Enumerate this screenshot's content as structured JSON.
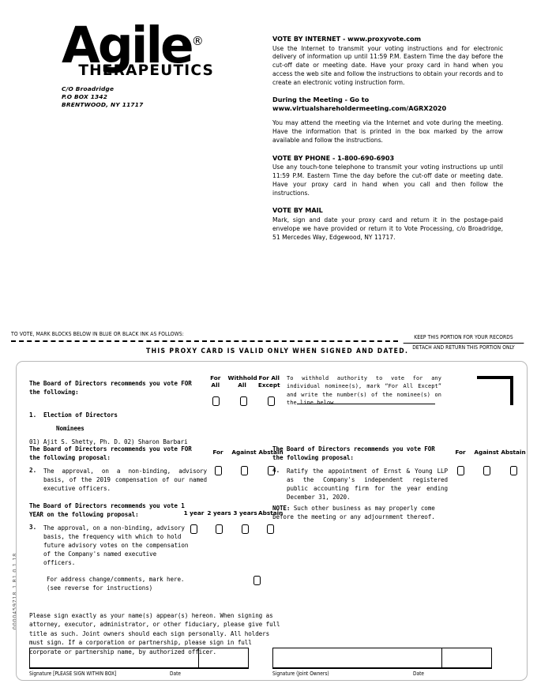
{
  "company": {
    "logo_text": "Agile",
    "logo_registered": "®",
    "logo_subtitle": "THERAPEUTICS",
    "address_line1": "C/O Broadridge",
    "address_line2": "P.O BOX 1342",
    "address_line3": "BRENTWOOD, NY 11717"
  },
  "instructions": {
    "internet_heading": "VOTE BY INTERNET - www.proxyvote.com",
    "internet_body": "Use the Internet to transmit your voting instructions and for electronic delivery of information up until 11:59 P.M. Eastern Time the day before the cut-off date or meeting date. Have your proxy card in hand when you access the web site and follow the instructions to obtain your records and to create an electronic voting instruction form.",
    "meeting_heading": "During the Meeting - Go to www.virtualshareholdermeeting.com/AGRX2020",
    "meeting_body": "You may attend the meeting via the Internet and vote during the meeting. Have the information that is printed in the box marked by the arrow available and follow the instructions.",
    "phone_heading": "VOTE BY PHONE - 1-800-690-6903",
    "phone_body": "Use any touch-tone telephone to transmit your voting instructions up until 11:59 P.M. Eastern Time the day before the cut-off date or meeting date. Have your proxy card in hand when you call and then follow the instructions.",
    "mail_heading": "VOTE BY MAIL",
    "mail_body": "Mark, sign and date your proxy card and return it in the postage-paid envelope we have provided or return it to Vote Processing, c/o Broadridge, 51 Mercedes Way, Edgewood, NY 11717."
  },
  "detach": {
    "mark_blocks": "TO VOTE, MARK BLOCKS BELOW IN BLUE OR BLACK INK AS FOLLOWS:",
    "valid_notice": "THIS  PROXY  CARD  IS  VALID  ONLY  WHEN  SIGNED  AND  DATED.",
    "keep_portion": "KEEP THIS PORTION FOR YOUR RECORDS",
    "detach_portion": "DETACH AND RETURN THIS PORTION ONLY"
  },
  "card": {
    "rec_for_following": "The Board of Directors recommends you vote FOR the following:",
    "rec_for_proposal": "The Board of Directors recommends you vote FOR the following proposal:",
    "rec_one_year": "The Board of Directors recommends you vote 1 YEAR on the following proposal:",
    "item1_num": "1.",
    "item1_title": "Election of Directors",
    "nominees_label": "Nominees",
    "nominee_1": "01) Ajit S. Shetty, Ph. D.",
    "nominee_2": "02) Sharon Barbari",
    "col_for_all": "For\nAll",
    "col_withhold_all": "Withhold\nAll",
    "col_for_all_except": "For All\nExcept",
    "withhold_note": "To withhold authority to vote for any individual nominee(s), mark “For All Except” and write the number(s) of the nominee(s) on the line below.",
    "item2_num": "2.",
    "item2_text": "The approval, on a non-binding, advisory basis, of the 2019 compensation of our named executive officers.",
    "item4_num": "4.",
    "item4_text": "Ratify the appointment of Ernst & Young LLP as the Company's independent registered public accounting firm for the year ending December 31, 2020.",
    "item3_num": "3.",
    "item3_text": "The approval, on a non-binding, advisory basis, the frequency with which to hold future advisory votes on the compensation of the Company's named executive officers.",
    "col_for": "For",
    "col_against": "Against",
    "col_abstain": "Abstain",
    "col_1_year": "1 year",
    "col_2_years": "2 years",
    "col_3_years": "3 years",
    "col_abstain_freq": "Abstain",
    "note_label": "NOTE:",
    "note_text": " Such other business as may properly come before the meeting or any adjournment thereof.",
    "address_change_line1": "For address change/comments, mark here.",
    "address_change_line2": "(see reverse for instructions)",
    "signature_instructions": "Please sign exactly as your name(s) appear(s) hereon. When signing as attorney, executor, administrator, or other fiduciary, please give full title as such. Joint owners should each sign personally. All holders must sign. If a corporation or partnership, please sign in full corporate or partnership name, by authorized officer.",
    "sig_label_1": "Signature [PLEASE SIGN WITHIN BOX]",
    "sig_date_1": "Date",
    "sig_label_2": "Signature (Joint Owners)",
    "sig_date_2": "Date"
  },
  "form_id": "0000459718_1   R1.0.1.18"
}
